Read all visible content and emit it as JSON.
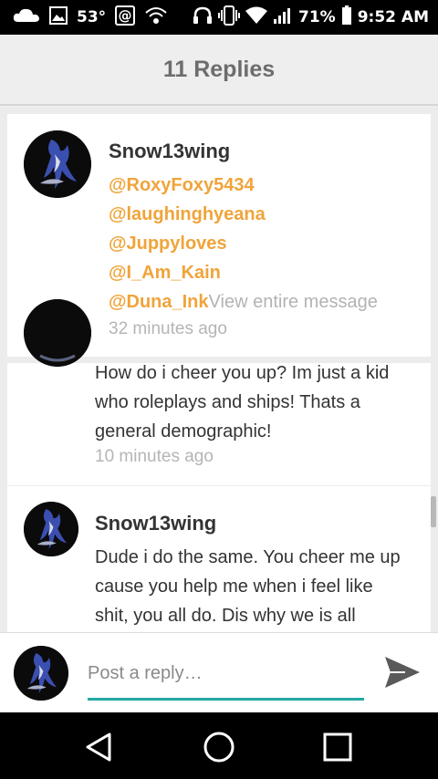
{
  "status_bar": {
    "temperature": "53°",
    "battery": "71%",
    "time": "9:52 AM"
  },
  "header": {
    "title": "11 Replies"
  },
  "replies": [
    {
      "username": "Snow13wing",
      "mentions": [
        "@RoxyFoxy5434",
        "@laughinghyeana",
        "@Juppyloves",
        "@I_Am_Kain",
        "@Duna_Ink"
      ],
      "view_more": "View entire message",
      "timestamp": "32 minutes ago"
    },
    {
      "lines": [
        "How do i cheer you up? Im just a kid",
        "who roleplays and ships! Thats a",
        "general demographic!"
      ],
      "timestamp": "10 minutes ago"
    },
    {
      "username": "Snow13wing",
      "lines": [
        "Dude i do the same. You cheer me up",
        "cause you help me when i feel like",
        "shit, you all do. Dis why we is all"
      ]
    }
  ],
  "reply_bar": {
    "placeholder": "Post a reply…"
  },
  "colors": {
    "mention": "#f0a43a",
    "accent_underline": "#23a8a2",
    "send_icon": "#5a5a5a"
  },
  "icons": {
    "status_left": [
      "cloud-icon",
      "image-icon",
      "at-icon",
      "wifi-call-icon"
    ],
    "status_right": [
      "headphones-icon",
      "vibrate-icon",
      "wifi-icon",
      "signal-icon",
      "battery-icon"
    ],
    "nav": [
      "back-icon",
      "home-icon",
      "recents-icon"
    ],
    "send": "send-icon"
  }
}
